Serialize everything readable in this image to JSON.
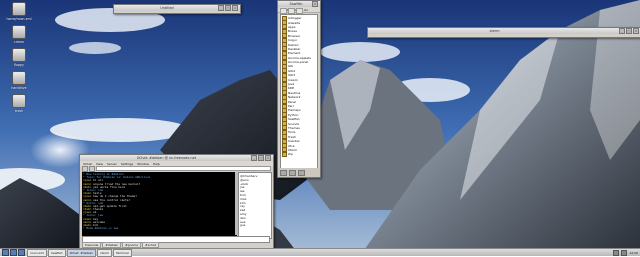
{
  "desktop": {
    "icons": [
      {
        "icon": "file-icon",
        "label": "home/noon.xml"
      },
      {
        "icon": "drive-icon",
        "label": "cdrom"
      },
      {
        "icon": "drive-icon",
        "label": "floppy"
      },
      {
        "icon": "drive-icon",
        "label": "harddrive"
      },
      {
        "icon": "trash-icon",
        "label": "trash"
      }
    ]
  },
  "windows": {
    "blank": {
      "title": "Untitled"
    },
    "list": {
      "title": "Sawfish",
      "menu": [
        "File",
        "Edit",
        "View",
        "Go"
      ],
      "items": [
        "Adlogger",
        "Adwaita",
        "Apps",
        "Boxes",
        "Browser",
        "Cogui",
        "Debian",
        "Deskbar",
        "Element",
        "Gnome-applets",
        "Gnome-panel",
        "Gtk",
        "Gtk2",
        "Gtk3",
        "Icewm",
        "Java",
        "KDE",
        "Nautilus",
        "Network",
        "Panel",
        "Perl",
        "Pixmaps",
        "Python",
        "Sawfish",
        "Sounds",
        "Themes",
        "Tools",
        "Trash",
        "Userbar",
        "Xfce",
        "Xterm",
        "Zip"
      ]
    },
    "long": {
      "title": "xterm"
    },
    "irc": {
      "title": "XChat: #debian @ irc.freenode.net",
      "menu": [
        "XChat",
        "View",
        "Server",
        "Settings",
        "Window",
        "Help"
      ],
      "lines": [
        {
          "t": "",
          "n": "*",
          "m": "Now talking on #debian",
          "c": "sys"
        },
        {
          "t": "",
          "n": "*",
          "m": "Topic for #debian is: Debian GNU/Linux",
          "c": "sys"
        },
        {
          "t": "",
          "n": "<joe>",
          "m": "hi all",
          "c": "msg"
        },
        {
          "t": "",
          "n": "<ann>",
          "m": "anyone tried the new kernel?",
          "c": "msg"
        },
        {
          "t": "",
          "n": "<bob>",
          "m": "yes works fine here",
          "c": "msg"
        },
        {
          "t": "",
          "n": "*",
          "m": "Joins: tom",
          "c": "sys"
        },
        {
          "t": "",
          "n": "<tom>",
          "m": "hello",
          "c": "msg"
        },
        {
          "t": "",
          "n": "<joe>",
          "m": "how do I change the theme?",
          "c": "msg"
        },
        {
          "t": "",
          "n": "<ann>",
          "m": "use the control center",
          "c": "msg"
        },
        {
          "t": "",
          "n": "*",
          "m": "Quits: sam",
          "c": "sys"
        },
        {
          "t": "",
          "n": "<bob>",
          "m": "apt-get update first",
          "c": "msg"
        },
        {
          "t": "",
          "n": "<tom>",
          "m": "thanks",
          "c": "msg"
        },
        {
          "t": "",
          "n": "<joe>",
          "m": "ok",
          "c": "msg"
        },
        {
          "t": "",
          "n": "*",
          "m": "Joins: lee",
          "c": "sys"
        },
        {
          "t": "",
          "n": "<lee>",
          "m": "hey",
          "c": "msg"
        },
        {
          "t": "",
          "n": "<ann>",
          "m": "welcome",
          "c": "msg"
        },
        {
          "t": "",
          "n": "<bob>",
          "m": "brb",
          "c": "msg"
        },
        {
          "t": "",
          "n": "*",
          "m": "Mode #debian +v lee",
          "c": "sys"
        }
      ],
      "nicks": [
        "@ChanServ",
        "@ann",
        "+bob",
        "joe",
        "lee",
        "tom",
        "max",
        "kim",
        "ray",
        "zed",
        "amy",
        "dan",
        "eve",
        "gus"
      ],
      "tabs": [
        "freenode",
        "#debian",
        "#gnome",
        "#xchat"
      ]
    }
  },
  "taskbar": {
    "tasks": [
      "noon.xml",
      "Sawfish",
      "XChat: #debian",
      "xterm",
      "Terminal"
    ],
    "clock": "12:00"
  }
}
